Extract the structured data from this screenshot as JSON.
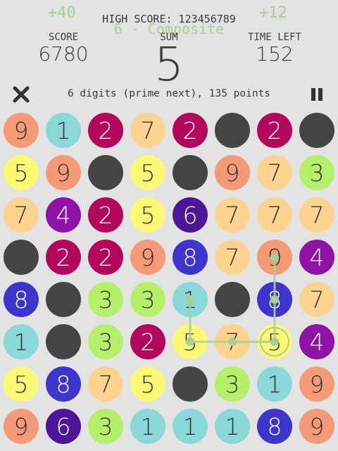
{
  "header": {
    "bonus_left": "+40",
    "bonus_right": "+12",
    "last_result": "6 - Composite",
    "high_score": "HIGH SCORE: 123456789",
    "score_label": "SCORE",
    "score_value": "6780",
    "sum_label": "SUM",
    "sum_value": "5",
    "time_label": "TIME LEFT",
    "time_value": "152"
  },
  "toolbar": {
    "close_icon": "close-x-icon",
    "pause_icon": "pause-icon",
    "status_text": "6 digits (prime next), 135 points"
  },
  "colors": {
    "background": "#e3e3e3",
    "blocked": "#444444",
    "salmon": "#f59a76",
    "cyan": "#8ad8d8",
    "magenta": "#b3075e",
    "peach": "#fdd48f",
    "yellow": "#fbf976",
    "lime": "#b6f06a",
    "purple": "#8e12a6",
    "blue": "#3f35cd",
    "indigo": "#4d1699",
    "path": "#a9cf96"
  },
  "board": {
    "rows": 8,
    "cols": 8,
    "cells": [
      [
        {
          "d": "9",
          "c": "salmon"
        },
        {
          "d": "1",
          "c": "cyan"
        },
        {
          "d": "2",
          "c": "magenta"
        },
        {
          "d": "7",
          "c": "peach"
        },
        {
          "d": "2",
          "c": "magenta"
        },
        {
          "d": "",
          "c": "blocked"
        },
        {
          "d": "2",
          "c": "magenta"
        },
        {
          "d": "",
          "c": "blocked"
        }
      ],
      [
        {
          "d": "5",
          "c": "yellow"
        },
        {
          "d": "9",
          "c": "salmon"
        },
        {
          "d": "",
          "c": "blocked"
        },
        {
          "d": "5",
          "c": "yellow"
        },
        {
          "d": "",
          "c": "blocked"
        },
        {
          "d": "9",
          "c": "salmon"
        },
        {
          "d": "7",
          "c": "peach"
        },
        {
          "d": "3",
          "c": "lime"
        }
      ],
      [
        {
          "d": "7",
          "c": "peach"
        },
        {
          "d": "4",
          "c": "purple"
        },
        {
          "d": "2",
          "c": "magenta"
        },
        {
          "d": "5",
          "c": "yellow"
        },
        {
          "d": "6",
          "c": "indigo"
        },
        {
          "d": "7",
          "c": "peach"
        },
        {
          "d": "7",
          "c": "peach"
        },
        {
          "d": "7",
          "c": "peach"
        }
      ],
      [
        {
          "d": "",
          "c": "blocked"
        },
        {
          "d": "2",
          "c": "magenta"
        },
        {
          "d": "2",
          "c": "magenta"
        },
        {
          "d": "9",
          "c": "salmon"
        },
        {
          "d": "8",
          "c": "blue"
        },
        {
          "d": "7",
          "c": "peach"
        },
        {
          "d": "9",
          "c": "salmon"
        },
        {
          "d": "4",
          "c": "purple"
        }
      ],
      [
        {
          "d": "8",
          "c": "blue"
        },
        {
          "d": "",
          "c": "blocked"
        },
        {
          "d": "3",
          "c": "lime"
        },
        {
          "d": "3",
          "c": "lime"
        },
        {
          "d": "1",
          "c": "cyan"
        },
        {
          "d": "",
          "c": "blocked"
        },
        {
          "d": "8",
          "c": "blue"
        },
        {
          "d": "7",
          "c": "peach"
        }
      ],
      [
        {
          "d": "1",
          "c": "cyan"
        },
        {
          "d": "",
          "c": "blocked"
        },
        {
          "d": "3",
          "c": "lime"
        },
        {
          "d": "2",
          "c": "magenta"
        },
        {
          "d": "5",
          "c": "yellow"
        },
        {
          "d": "7",
          "c": "peach"
        },
        {
          "d": "5",
          "c": "yellow"
        },
        {
          "d": "4",
          "c": "purple"
        }
      ],
      [
        {
          "d": "5",
          "c": "yellow"
        },
        {
          "d": "8",
          "c": "blue"
        },
        {
          "d": "7",
          "c": "peach"
        },
        {
          "d": "5",
          "c": "yellow"
        },
        {
          "d": "",
          "c": "blocked"
        },
        {
          "d": "3",
          "c": "lime"
        },
        {
          "d": "1",
          "c": "cyan"
        },
        {
          "d": "9",
          "c": "salmon"
        }
      ],
      [
        {
          "d": "9",
          "c": "salmon"
        },
        {
          "d": "6",
          "c": "indigo"
        },
        {
          "d": "3",
          "c": "lime"
        },
        {
          "d": "1",
          "c": "cyan"
        },
        {
          "d": "1",
          "c": "cyan"
        },
        {
          "d": "1",
          "c": "cyan"
        },
        {
          "d": "8",
          "c": "blue"
        },
        {
          "d": "9",
          "c": "salmon"
        }
      ]
    ],
    "selected_path": [
      [
        4,
        4
      ],
      [
        5,
        4
      ],
      [
        5,
        5
      ],
      [
        5,
        6
      ],
      [
        4,
        6
      ],
      [
        3,
        6
      ]
    ]
  }
}
